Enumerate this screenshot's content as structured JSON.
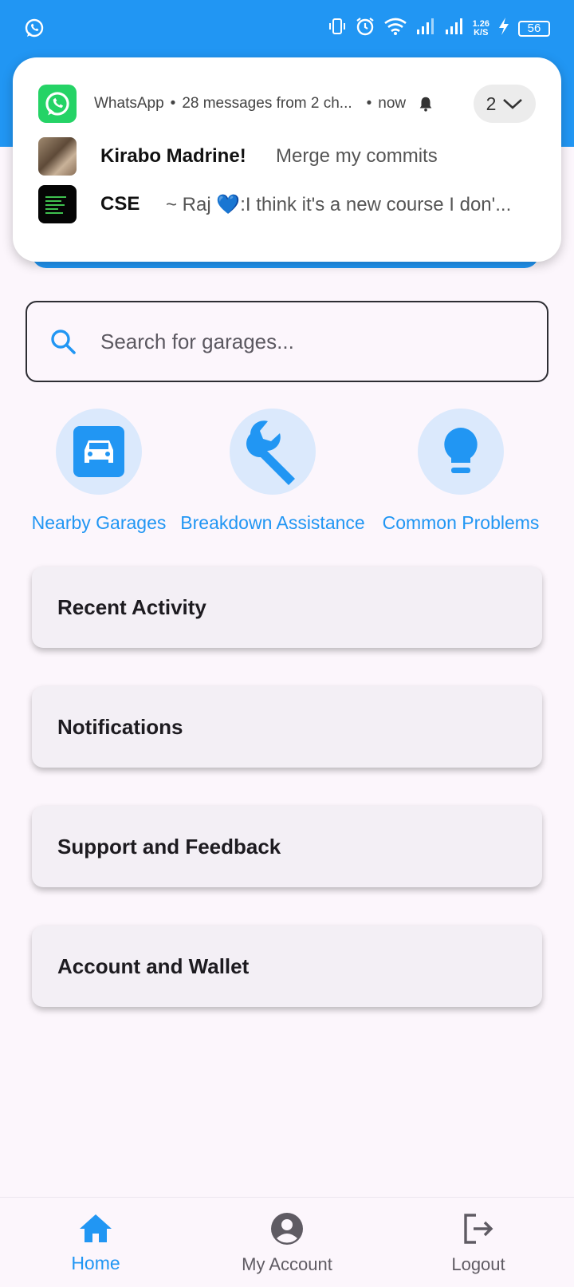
{
  "status_bar": {
    "net_speed_value": "1.26",
    "net_speed_unit": "K/S",
    "battery": "56"
  },
  "notification": {
    "app": "WhatsApp",
    "summary": "28 messages from 2 ch...",
    "time": "now",
    "count": "2",
    "messages": [
      {
        "sender": "Kirabo Madrine!",
        "text": "Merge my commits"
      },
      {
        "sender": "CSE",
        "text": "~ Raj 💙:I think it's a new course I don'..."
      }
    ]
  },
  "search": {
    "placeholder": "Search for garages..."
  },
  "quick_actions": [
    {
      "label": "Nearby Garages",
      "icon": "car-icon"
    },
    {
      "label": "Breakdown Assistance",
      "icon": "wrench-icon"
    },
    {
      "label": "Common Problems",
      "icon": "lightbulb-icon"
    }
  ],
  "cards": [
    {
      "label": "Recent Activity"
    },
    {
      "label": "Notifications"
    },
    {
      "label": "Support and Feedback"
    },
    {
      "label": "Account and Wallet"
    }
  ],
  "bottom_nav": {
    "items": [
      {
        "label": "Home",
        "icon": "home-icon",
        "active": true
      },
      {
        "label": "My Account",
        "icon": "account-circle-icon",
        "active": false
      },
      {
        "label": "Logout",
        "icon": "logout-icon",
        "active": false
      }
    ]
  },
  "colors": {
    "primary": "#2196f3",
    "background": "#fcf6fc",
    "card": "#f3eff5",
    "nav_inactive": "#5f5b63"
  }
}
